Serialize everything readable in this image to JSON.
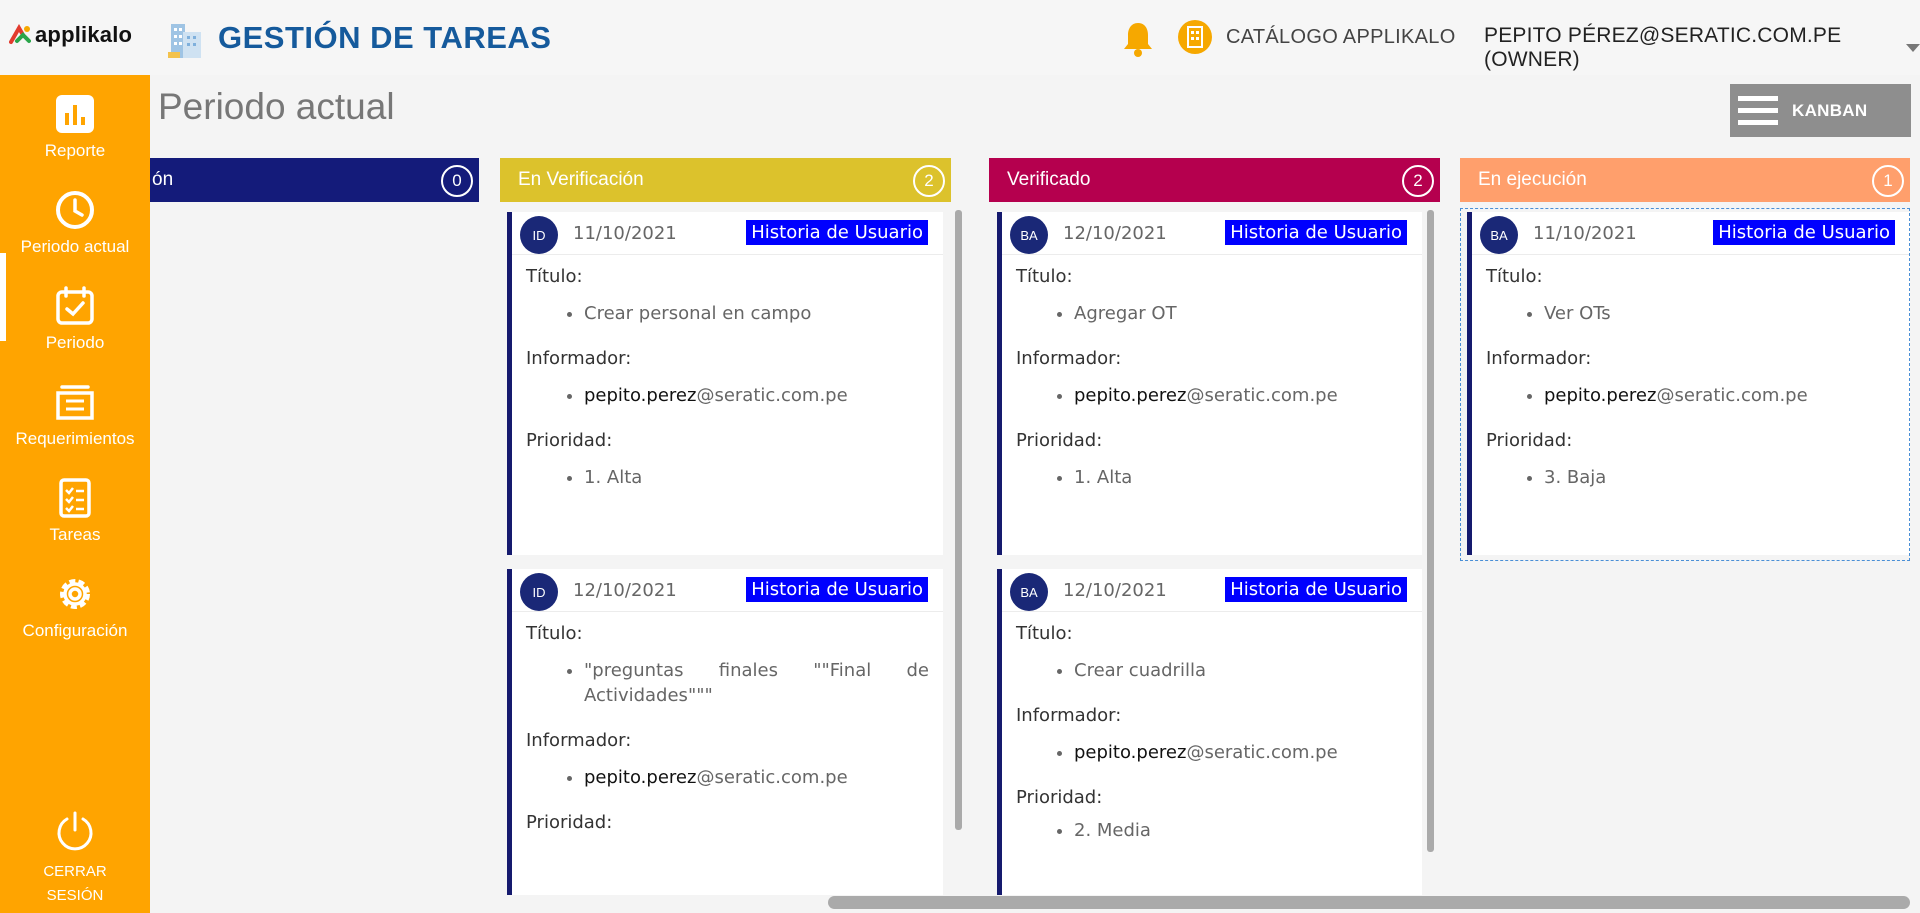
{
  "header": {
    "brand": "applikalo",
    "title": "GESTIÓN DE TAREAS",
    "catalog_label": "CATÁLOGO APPLIKALO",
    "user_label": "PEPITO PÉREZ@SERATIC.COM.PE (OWNER)"
  },
  "sidebar": {
    "items": [
      {
        "label": "Reporte",
        "icon": "bar-chart-icon"
      },
      {
        "label": "Periodo actual",
        "icon": "clock-icon"
      },
      {
        "label": "Periodo",
        "icon": "calendar-icon"
      },
      {
        "label": "Requerimientos",
        "icon": "folder-icon"
      },
      {
        "label": "Tareas",
        "icon": "checklist-icon"
      },
      {
        "label": "Configuración",
        "icon": "gear-icon"
      }
    ],
    "active_index": 1,
    "logout_label": "CERRAR\nSESIÓN"
  },
  "page": {
    "title": "Periodo actual",
    "view_button": "KANBAN"
  },
  "labels": {
    "titulo": "Título:",
    "informador": "Informador:",
    "prioridad": "Prioridad:"
  },
  "columns": [
    {
      "title": "ón",
      "count": "0",
      "color": "#141b7a",
      "cards": []
    },
    {
      "title": "En Verificación",
      "count": "2",
      "color": "#dcc22c",
      "cards": [
        {
          "avatar": "ID",
          "date": "11/10/2021",
          "type": "Historia de Usuario",
          "title": "Crear personal en campo",
          "reporter_user": "pepito.perez",
          "reporter_domain": "@seratic.com.pe",
          "priority": "1. Alta"
        },
        {
          "avatar": "ID",
          "date": "12/10/2021",
          "type": "Historia de Usuario",
          "title": "\"preguntas finales \"\"Final de Actividades\"\"\"",
          "reporter_user": "pepito.perez",
          "reporter_domain": "@seratic.com.pe",
          "priority": ""
        }
      ]
    },
    {
      "title": "Verificado",
      "count": "2",
      "color": "#b5004e",
      "cards": [
        {
          "avatar": "BA",
          "date": "12/10/2021",
          "type": "Historia de Usuario",
          "title": "Agregar OT",
          "reporter_user": "pepito.perez",
          "reporter_domain": "@seratic.com.pe",
          "priority": "1. Alta"
        },
        {
          "avatar": "BA",
          "date": "12/10/2021",
          "type": "Historia de Usuario",
          "title": "Crear cuadrilla",
          "reporter_user": "pepito.perez",
          "reporter_domain": "@seratic.com.pe",
          "priority": "2. Media"
        }
      ]
    },
    {
      "title": "En ejecución",
      "count": "1",
      "color": "#ff9f6c",
      "cards": [
        {
          "avatar": "BA",
          "date": "11/10/2021",
          "type": "Historia de Usuario",
          "title": "Ver OTs",
          "reporter_user": "pepito.perez",
          "reporter_domain": "@seratic.com.pe",
          "priority": "3. Baja"
        }
      ]
    }
  ],
  "colors": {
    "sidebar": "#ffa400",
    "title_blue": "#155a9c",
    "type_badge": "#0000ff",
    "card_border": "#151a6e"
  }
}
